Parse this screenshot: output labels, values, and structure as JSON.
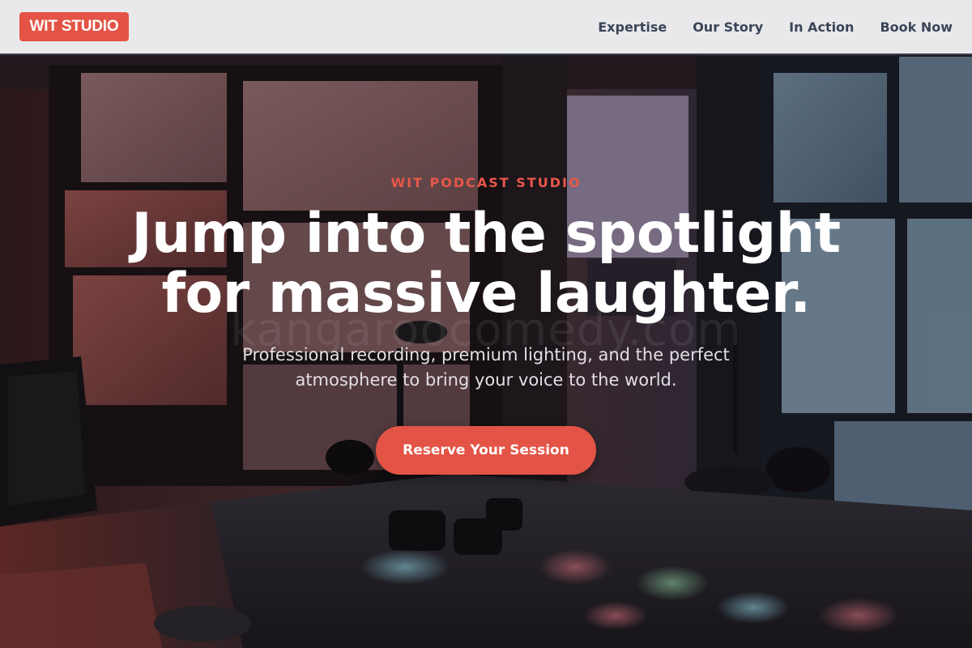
{
  "brand": {
    "logo": "WIT STUDIO",
    "accent": "#e35446"
  },
  "nav": {
    "items": [
      {
        "label": "Expertise"
      },
      {
        "label": "Our Story"
      },
      {
        "label": "In Action"
      },
      {
        "label": "Book Now"
      }
    ]
  },
  "hero": {
    "eyebrow": "WIT PODCAST STUDIO",
    "headline_line1": "Jump into the spotlight",
    "headline_line2": "for massive laughter.",
    "watermark": "kangaroocomedy.com",
    "subtitle_line1": "Professional recording, premium lighting, and the perfect",
    "subtitle_line2": "atmosphere to bring your voice to the world.",
    "cta_label": "Reserve Your Session"
  }
}
